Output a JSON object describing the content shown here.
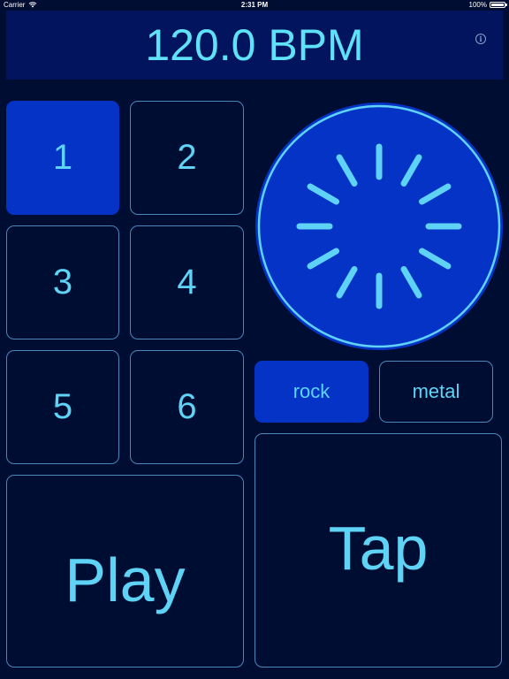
{
  "status_bar": {
    "carrier": "Carrier",
    "time": "2:31 PM",
    "battery": "100%",
    "battery_level": 1.0,
    "wifi_icon": "wifi-icon"
  },
  "header": {
    "tempo": "120.0 BPM",
    "info_icon_glyph": "i"
  },
  "pads": [
    {
      "label": "1",
      "selected": true
    },
    {
      "label": "2",
      "selected": false
    },
    {
      "label": "3",
      "selected": false
    },
    {
      "label": "4",
      "selected": false
    },
    {
      "label": "5",
      "selected": false
    },
    {
      "label": "6",
      "selected": false
    }
  ],
  "styles": [
    {
      "label": "rock",
      "selected": true
    },
    {
      "label": "metal",
      "selected": false
    }
  ],
  "controls": {
    "play_label": "Play",
    "tap_label": "Tap"
  },
  "dial": {
    "icon": "spinner-icon",
    "fill_color": "#0433c5",
    "ring_color": "#5fd3f5",
    "tick_color": "#5fd3f5"
  },
  "colors": {
    "background": "#000d33",
    "header": "#02145e",
    "accent": "#0433c5",
    "text": "#5fd3f5",
    "border": "#4a86b8"
  }
}
